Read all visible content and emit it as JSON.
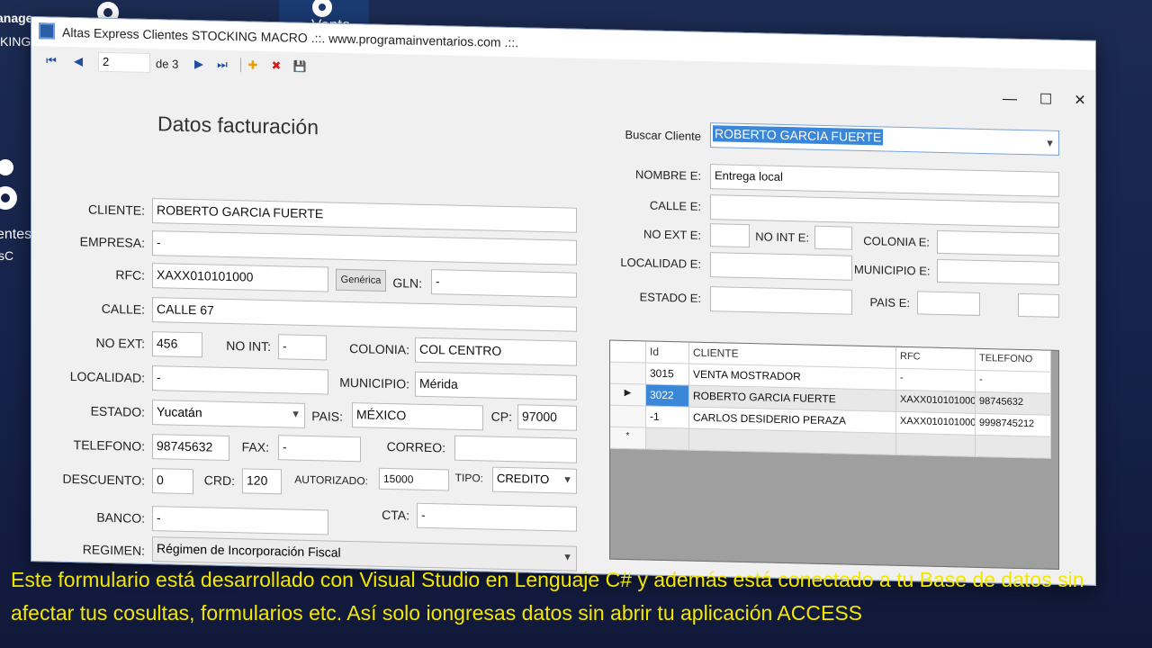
{
  "desktop": {
    "top_left_text_1": "anage",
    "top_left_text_2": "KING",
    "top_center_text": "Venta",
    "left_text_1": "entes",
    "left_text_2": "sC"
  },
  "window": {
    "title": "Altas Express Clientes STOCKING MACRO  .::. www.programainventarios.com .::.",
    "controls": {
      "minimize": "—",
      "maximize": "☐",
      "close": "✕"
    }
  },
  "toolbar": {
    "record_value": "2",
    "record_of": "de 3",
    "first_glyph": "⏮",
    "prev_glyph": "◀",
    "next_glyph": "▶",
    "last_glyph": "⏭",
    "add_glyph": "✚",
    "delete_glyph": "✖",
    "save_glyph": "💾"
  },
  "form": {
    "section_title": "Datos facturación",
    "cliente": {
      "label": "CLIENTE:",
      "value": "ROBERTO GARCIA FUERTE"
    },
    "empresa": {
      "label": "EMPRESA:",
      "value": "-"
    },
    "rfc": {
      "label": "RFC:",
      "value": "XAXX010101000"
    },
    "generica_button": "Genérica",
    "gln": {
      "label": "GLN:",
      "value": "-"
    },
    "calle": {
      "label": "CALLE:",
      "value": "CALLE 67"
    },
    "no_ext": {
      "label": "NO EXT:",
      "value": "456"
    },
    "no_int": {
      "label": "NO INT:",
      "value": "-"
    },
    "colonia": {
      "label": "COLONIA:",
      "value": "COL CENTRO"
    },
    "localidad": {
      "label": "LOCALIDAD:",
      "value": "-"
    },
    "municipio": {
      "label": "MUNICIPIO:",
      "value": "Mérida"
    },
    "estado": {
      "label": "ESTADO:",
      "value": "Yucatán"
    },
    "pais": {
      "label": "PAIS:",
      "value": "MÉXICO"
    },
    "cp": {
      "label": "CP:",
      "value": "97000"
    },
    "telefono": {
      "label": "TELEFONO:",
      "value": "98745632"
    },
    "fax": {
      "label": "FAX:",
      "value": "-"
    },
    "correo": {
      "label": "CORREO:",
      "value": ""
    },
    "descuento": {
      "label": "DESCUENTO:",
      "value": "0"
    },
    "crd": {
      "label": "CRD:",
      "value": "120"
    },
    "autorizado": {
      "label": "AUTORIZADO:",
      "value": "15000"
    },
    "tipo": {
      "label": "TIPO:",
      "value": "CREDITO"
    },
    "banco": {
      "label": "BANCO:",
      "value": "-"
    },
    "cta": {
      "label": "CTA:",
      "value": "-"
    },
    "regimen": {
      "label": "REGIMEN:",
      "value": "Régimen de Incorporación Fiscal"
    }
  },
  "delivery": {
    "buscar": {
      "label": "Buscar Cliente",
      "value": "ROBERTO GARCIA FUERTE"
    },
    "nombre_e": {
      "label": "NOMBRE E:",
      "value": "Entrega local"
    },
    "calle_e": {
      "label": "CALLE E:",
      "value": ""
    },
    "no_ext_e": {
      "label": "NO EXT E:",
      "value": ""
    },
    "no_int_e": {
      "label": "NO INT E:",
      "value": ""
    },
    "colonia_e": {
      "label": "COLONIA E:",
      "value": ""
    },
    "localidad_e": {
      "label": "LOCALIDAD E:",
      "value": ""
    },
    "municipio_e": {
      "label": "MUNICIPIO E:",
      "value": ""
    },
    "estado_e": {
      "label": "ESTADO E:",
      "value": ""
    },
    "pais_e": {
      "label": "PAIS E:",
      "value": ""
    },
    "extra_e": {
      "value": ""
    }
  },
  "grid": {
    "headers": [
      "Id",
      "CLIENTE",
      "RFC",
      "TELEFONO"
    ],
    "rows": [
      {
        "marker": "",
        "id": "3015",
        "cliente": "VENTA MOSTRADOR",
        "rfc": "-",
        "telefono": "-"
      },
      {
        "marker": "▶",
        "id": "3022",
        "cliente": "ROBERTO GARCIA FUERTE",
        "rfc": "XAXX010101000",
        "telefono": "98745632"
      },
      {
        "marker": "",
        "id": "-1",
        "cliente": "CARLOS DESIDERIO PERAZA",
        "rfc": "XAXX010101000",
        "telefono": "9998745212"
      }
    ],
    "new_row_marker": "*"
  },
  "caption": "Este formulario está desarrollado con Visual Studio en Lenguaje C# y además está conectado a tu Base de datos sin afectar tus cosultas, formularios etc. Así solo iongresas datos sin abrir tu aplicación ACCESS"
}
